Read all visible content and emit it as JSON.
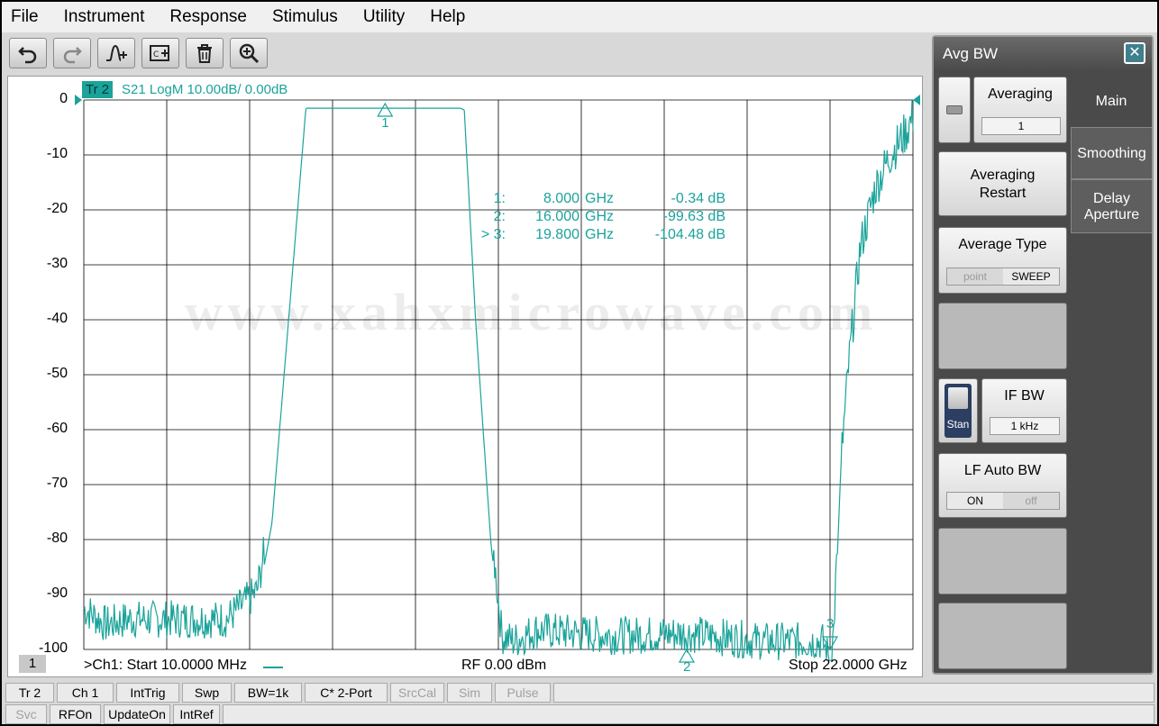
{
  "menu": [
    "File",
    "Instrument",
    "Response",
    "Stimulus",
    "Utility",
    "Help"
  ],
  "toolbar": {
    "buttons": [
      {
        "name": "undo-icon"
      },
      {
        "name": "redo-icon"
      },
      {
        "name": "add-marker-icon"
      },
      {
        "name": "channel-trace-icon"
      },
      {
        "name": "delete-icon"
      },
      {
        "name": "zoom-icon"
      }
    ]
  },
  "trace": {
    "id": "Tr 2",
    "description": "S21 LogM 10.00dB/  0.00dB",
    "color": "#1aa39a"
  },
  "markers": [
    {
      "prefix": "1:",
      "freq": "8.000",
      "unit": "GHz",
      "value": "-0.34 dB"
    },
    {
      "prefix": "2:",
      "freq": "16.000",
      "unit": "GHz",
      "value": "-99.63 dB"
    },
    {
      "prefix": "> 3:",
      "freq": "19.800",
      "unit": "GHz",
      "value": "-104.48 dB"
    }
  ],
  "marker_labels": [
    "1",
    "2",
    "3"
  ],
  "watermark": "www.xahxmicrowave.com",
  "channel_number": "1",
  "footer": {
    "start": ">Ch1:  Start  10.0000 MHz",
    "rf": "RF    0.00 dBm",
    "stop": "Stop  22.0000 GHz"
  },
  "chart_data": {
    "type": "line",
    "ylim": [
      -100,
      0
    ],
    "y_ticks": [
      "0",
      "-10",
      "-20",
      "-30",
      "-40",
      "-50",
      "-60",
      "-70",
      "-80",
      "-90",
      "-100"
    ],
    "xlim_ghz": [
      0.01,
      22.0
    ],
    "grid": true,
    "series": [
      {
        "x_ghz": [
          0.01,
          0.6,
          1.2,
          2.2,
          3.8,
          4.6,
          5.0,
          5.9,
          10.0,
          10.1,
          10.4,
          10.8,
          11.1,
          11.4,
          12.0,
          14.0,
          16.0,
          18.0,
          19.6,
          19.8,
          19.9,
          20.1,
          20.3,
          20.6,
          21.0,
          21.4,
          21.8,
          22.0
        ],
        "y_db": [
          -95,
          -98,
          -97,
          -97,
          -97,
          -92,
          -77,
          -1.5,
          -1.5,
          -1.8,
          -40,
          -80,
          -100,
          -101,
          -99,
          -100,
          -99.6,
          -101,
          -101,
          -104.5,
          -99,
          -65,
          -48,
          -27,
          -16,
          -10,
          -6,
          -3
        ]
      }
    ]
  },
  "panel": {
    "title": "Avg BW",
    "tabs": [
      "Main",
      "Smoothing",
      "Delay Aperture"
    ],
    "averaging_label": "Averaging",
    "averaging_value": "1",
    "averaging_restart": "Averaging Restart",
    "average_type_label": "Average Type",
    "average_type_options": [
      "point",
      "SWEEP"
    ],
    "stan_label": "Stan",
    "if_bw_label": "IF BW",
    "if_bw_value": "1 kHz",
    "lf_auto_bw_label": "LF Auto BW",
    "lf_auto_bw_options": [
      "ON",
      "off"
    ]
  },
  "status_row1": [
    {
      "label": "Tr 2",
      "enabled": true
    },
    {
      "label": "Ch 1",
      "enabled": true
    },
    {
      "label": "IntTrig",
      "enabled": true
    },
    {
      "label": "Swp",
      "enabled": true
    },
    {
      "label": "BW=1k",
      "enabled": true
    },
    {
      "label": "C* 2-Port",
      "enabled": true
    },
    {
      "label": "SrcCal",
      "enabled": false
    },
    {
      "label": "Sim",
      "enabled": false
    },
    {
      "label": "Pulse",
      "enabled": false
    }
  ],
  "status_row2": [
    {
      "label": "Svc",
      "enabled": false
    },
    {
      "label": "RFOn",
      "enabled": true
    },
    {
      "label": "UpdateOn",
      "enabled": true
    },
    {
      "label": "IntRef",
      "enabled": true
    }
  ]
}
